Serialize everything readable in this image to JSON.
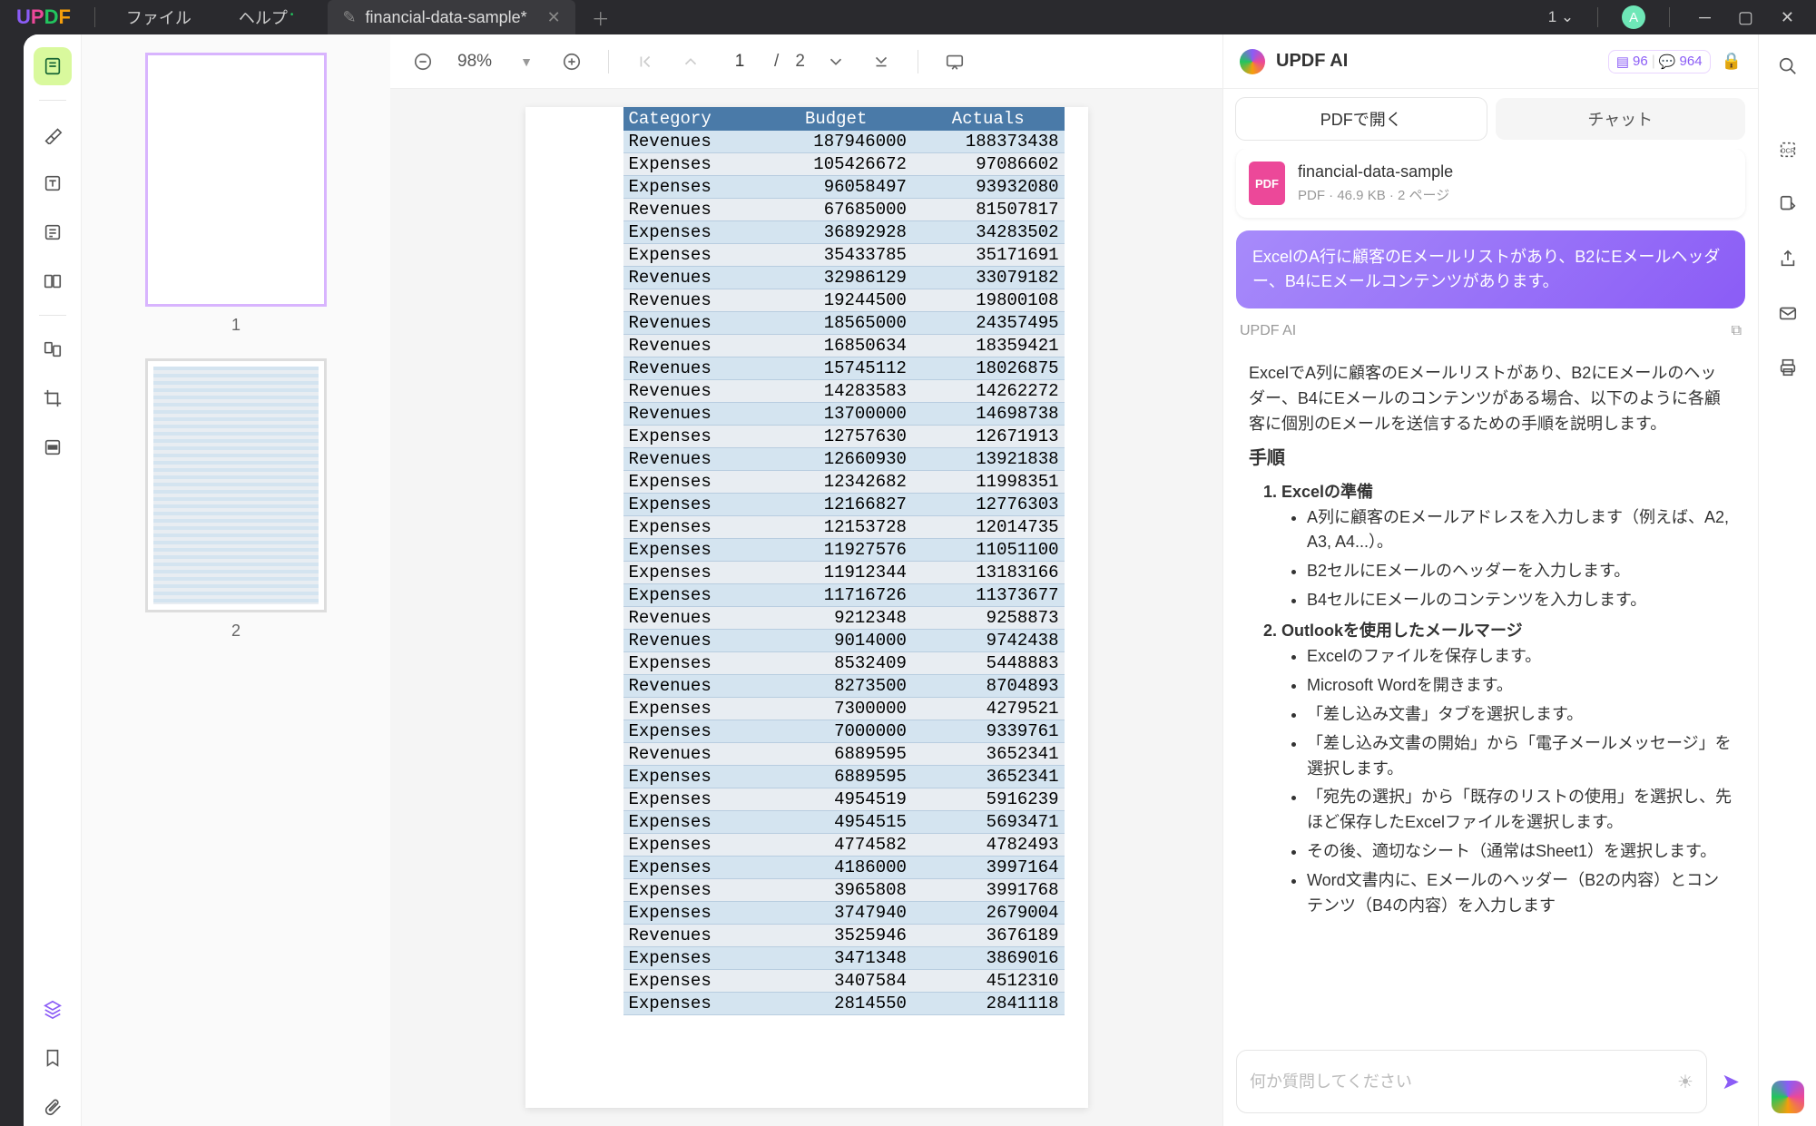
{
  "titlebar": {
    "menu_file": "ファイル",
    "menu_help": "ヘルプ",
    "tab_title": "financial-data-sample*",
    "num_indicator": "1",
    "avatar_letter": "A"
  },
  "thumbs": {
    "page1": "1",
    "page2": "2"
  },
  "doc_toolbar": {
    "zoom": "98%",
    "page_current": "1",
    "page_sep": "/",
    "page_total": "2"
  },
  "table": {
    "headers": [
      "Category",
      "Budget",
      "Actuals"
    ],
    "rows": [
      [
        "Revenues",
        "187946000",
        "188373438"
      ],
      [
        "Expenses",
        "105426672",
        "97086602"
      ],
      [
        "Expenses",
        "96058497",
        "93932080"
      ],
      [
        "Revenues",
        "67685000",
        "81507817"
      ],
      [
        "Expenses",
        "36892928",
        "34283502"
      ],
      [
        "Expenses",
        "35433785",
        "35171691"
      ],
      [
        "Revenues",
        "32986129",
        "33079182"
      ],
      [
        "Revenues",
        "19244500",
        "19800108"
      ],
      [
        "Revenues",
        "18565000",
        "24357495"
      ],
      [
        "Revenues",
        "16850634",
        "18359421"
      ],
      [
        "Revenues",
        "15745112",
        "18026875"
      ],
      [
        "Revenues",
        "14283583",
        "14262272"
      ],
      [
        "Revenues",
        "13700000",
        "14698738"
      ],
      [
        "Expenses",
        "12757630",
        "12671913"
      ],
      [
        "Revenues",
        "12660930",
        "13921838"
      ],
      [
        "Expenses",
        "12342682",
        "11998351"
      ],
      [
        "Expenses",
        "12166827",
        "12776303"
      ],
      [
        "Expenses",
        "12153728",
        "12014735"
      ],
      [
        "Expenses",
        "11927576",
        "11051100"
      ],
      [
        "Expenses",
        "11912344",
        "13183166"
      ],
      [
        "Expenses",
        "11716726",
        "11373677"
      ],
      [
        "Revenues",
        "9212348",
        "9258873"
      ],
      [
        "Revenues",
        "9014000",
        "9742438"
      ],
      [
        "Expenses",
        "8532409",
        "5448883"
      ],
      [
        "Revenues",
        "8273500",
        "8704893"
      ],
      [
        "Expenses",
        "7300000",
        "4279521"
      ],
      [
        "Expenses",
        "7000000",
        "9339761"
      ],
      [
        "Revenues",
        "6889595",
        "3652341"
      ],
      [
        "Expenses",
        "6889595",
        "3652341"
      ],
      [
        "Expenses",
        "4954519",
        "5916239"
      ],
      [
        "Expenses",
        "4954515",
        "5693471"
      ],
      [
        "Expenses",
        "4774582",
        "4782493"
      ],
      [
        "Expenses",
        "4186000",
        "3997164"
      ],
      [
        "Expenses",
        "3965808",
        "3991768"
      ],
      [
        "Expenses",
        "3747940",
        "2679004"
      ],
      [
        "Revenues",
        "3525946",
        "3676189"
      ],
      [
        "Expenses",
        "3471348",
        "3869016"
      ],
      [
        "Expenses",
        "3407584",
        "4512310"
      ],
      [
        "Expenses",
        "2814550",
        "2841118"
      ]
    ]
  },
  "ai": {
    "title": "UPDF AI",
    "badge1": "96",
    "badge2": "964",
    "tab_pdf": "PDFで開く",
    "tab_chat": "チャット",
    "file_name": "financial-data-sample",
    "file_meta": "PDF · 46.9 KB · 2 ページ",
    "file_badge": "PDF",
    "user_message": "ExcelのA行に顧客のEメールリストがあり、B2にEメールヘッダー、B4にEメールコンテンツがあります。",
    "label": "UPDF AI",
    "resp_intro": "ExcelでA列に顧客のEメールリストがあり、B2にEメールのヘッダー、B4にEメールのコンテンツがある場合、以下のように各顧客に個別のEメールを送信するための手順を説明します。",
    "resp_heading": "手順",
    "step1_title": "Excelの準備",
    "step1_items": [
      "A列に顧客のEメールアドレスを入力します（例えば、A2, A3, A4...）。",
      "B2セルにEメールのヘッダーを入力します。",
      "B4セルにEメールのコンテンツを入力します。"
    ],
    "step2_title": "Outlookを使用したメールマージ",
    "step2_items": [
      "Excelのファイルを保存します。",
      "Microsoft Wordを開きます。",
      "「差し込み文書」タブを選択します。",
      "「差し込み文書の開始」から「電子メールメッセージ」を選択します。",
      "「宛先の選択」から「既存のリストの使用」を選択し、先ほど保存したExcelファイルを選択します。",
      "その後、適切なシート（通常はSheet1）を選択します。",
      "Word文書内に、Eメールのヘッダー（B2の内容）とコンテンツ（B4の内容）を入力します"
    ],
    "input_placeholder": "何か質問してください"
  }
}
